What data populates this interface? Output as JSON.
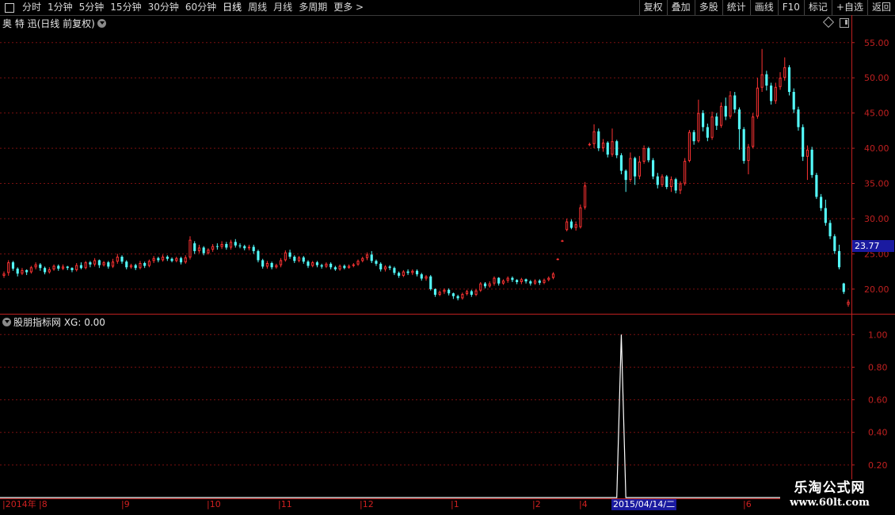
{
  "toolbar": {
    "periods": [
      "分时",
      "1分钟",
      "5分钟",
      "15分钟",
      "30分钟",
      "60分钟",
      "日线",
      "周线",
      "月线",
      "多周期",
      "更多 >"
    ],
    "active_period": "日线",
    "right_buttons": [
      "复权",
      "叠加",
      "多股",
      "统计",
      "画线",
      "F10",
      "标记",
      "+自选",
      "返回"
    ]
  },
  "stock": {
    "title": "奥 特 迅(日线 前复权)",
    "last_price_tag": "23.77"
  },
  "indicator": {
    "title": "股朋指标网  XG: 0.00"
  },
  "price_axis": {
    "labels": [
      "55.00",
      "50.00",
      "45.00",
      "40.00",
      "35.00",
      "30.00",
      "25.00",
      "20.00"
    ],
    "colors": {
      "up": "#ff3333",
      "down": "#54fcfc",
      "grid": "#7a1010",
      "axis": "#c02020"
    }
  },
  "indicator_axis": {
    "labels": [
      "1.00",
      "0.80",
      "0.60",
      "0.40",
      "0.20"
    ]
  },
  "time_axis": {
    "labels": [
      "2014年",
      "8",
      "9",
      "10",
      "11",
      "12",
      "1",
      "2",
      "4",
      "6"
    ],
    "cursor_date": "2015/04/14/二"
  },
  "watermark": {
    "name": "乐淘公式网",
    "url": "www.60lt.com"
  },
  "chart_data": [
    {
      "type": "candlestick",
      "title": "奥 特 迅(日线 前复权)",
      "ylim": [
        16.5,
        57
      ],
      "candles": [
        [
          21.9,
          22.2,
          21.6,
          22.5
        ],
        [
          22.3,
          23.8,
          21.9,
          24.1
        ],
        [
          23.8,
          22.9,
          22.6,
          24.0
        ],
        [
          22.9,
          22.2,
          21.8,
          23.1
        ],
        [
          22.2,
          22.7,
          22.0,
          23.0
        ],
        [
          22.7,
          22.4,
          22.0,
          22.8
        ],
        [
          22.4,
          23.1,
          22.2,
          23.3
        ],
        [
          23.1,
          23.5,
          22.8,
          23.8
        ],
        [
          23.5,
          23.0,
          22.6,
          23.7
        ],
        [
          23.0,
          22.4,
          22.1,
          23.2
        ],
        [
          22.4,
          22.8,
          22.2,
          23.1
        ],
        [
          22.8,
          23.3,
          22.6,
          23.5
        ],
        [
          23.3,
          22.9,
          22.6,
          23.5
        ],
        [
          22.9,
          23.2,
          22.7,
          23.5
        ],
        [
          23.2,
          23.0,
          22.7,
          23.3
        ],
        [
          23.0,
          22.7,
          22.4,
          23.1
        ],
        [
          22.7,
          23.4,
          22.5,
          23.7
        ],
        [
          23.4,
          23.0,
          22.8,
          23.8
        ],
        [
          23.0,
          23.8,
          22.8,
          24.0
        ],
        [
          23.8,
          23.5,
          23.1,
          24.0
        ],
        [
          23.5,
          24.1,
          23.2,
          24.4
        ],
        [
          24.1,
          23.4,
          23.0,
          24.2
        ],
        [
          23.4,
          23.8,
          23.2,
          24.0
        ],
        [
          23.8,
          23.2,
          22.9,
          24.0
        ],
        [
          23.2,
          23.9,
          23.0,
          24.3
        ],
        [
          23.9,
          24.6,
          23.6,
          25.0
        ],
        [
          24.6,
          23.9,
          23.6,
          24.8
        ],
        [
          23.9,
          23.1,
          22.8,
          24.1
        ],
        [
          23.1,
          23.4,
          22.9,
          23.6
        ],
        [
          23.4,
          23.0,
          22.7,
          23.6
        ],
        [
          23.0,
          23.7,
          22.8,
          24.0
        ],
        [
          23.7,
          23.3,
          23.0,
          23.9
        ],
        [
          23.3,
          24.0,
          23.1,
          24.2
        ],
        [
          24.0,
          24.4,
          23.7,
          24.7
        ],
        [
          24.4,
          24.1,
          23.8,
          24.6
        ],
        [
          24.1,
          24.6,
          23.9,
          24.9
        ],
        [
          24.6,
          24.3,
          24.0,
          24.8
        ],
        [
          24.3,
          24.0,
          23.8,
          24.5
        ],
        [
          24.0,
          24.4,
          23.8,
          24.6
        ],
        [
          24.4,
          23.8,
          23.5,
          24.6
        ],
        [
          23.8,
          24.5,
          23.6,
          24.8
        ],
        [
          24.5,
          27.0,
          24.2,
          27.5
        ],
        [
          26.5,
          25.4,
          25.0,
          26.8
        ],
        [
          25.4,
          25.9,
          25.1,
          26.3
        ],
        [
          25.9,
          25.1,
          24.8,
          26.1
        ],
        [
          25.1,
          25.6,
          24.9,
          25.8
        ],
        [
          25.6,
          26.1,
          25.3,
          26.4
        ],
        [
          26.1,
          26.0,
          25.6,
          26.5
        ],
        [
          26.0,
          26.4,
          25.7,
          26.8
        ],
        [
          26.4,
          25.9,
          25.6,
          26.7
        ],
        [
          25.9,
          26.7,
          25.6,
          27.0
        ],
        [
          26.7,
          26.2,
          25.9,
          27.1
        ],
        [
          26.2,
          26.1,
          25.8,
          26.5
        ],
        [
          26.1,
          25.8,
          25.5,
          26.3
        ],
        [
          25.8,
          26.0,
          25.5,
          26.3
        ],
        [
          26.0,
          25.4,
          25.0,
          26.3
        ],
        [
          25.4,
          24.1,
          23.8,
          25.6
        ],
        [
          24.1,
          23.2,
          22.9,
          24.3
        ],
        [
          23.2,
          23.7,
          22.9,
          24.0
        ],
        [
          23.7,
          23.1,
          22.8,
          23.9
        ],
        [
          23.1,
          23.4,
          22.9,
          23.6
        ],
        [
          23.4,
          24.1,
          23.1,
          24.4
        ],
        [
          24.1,
          25.2,
          23.9,
          25.5
        ],
        [
          25.2,
          24.6,
          24.3,
          25.6
        ],
        [
          24.6,
          24.0,
          23.7,
          24.8
        ],
        [
          24.0,
          24.5,
          23.8,
          24.7
        ],
        [
          24.5,
          23.9,
          23.6,
          24.7
        ],
        [
          23.9,
          23.3,
          23.0,
          24.1
        ],
        [
          23.3,
          23.8,
          23.1,
          24.0
        ],
        [
          23.8,
          23.4,
          23.1,
          24.0
        ],
        [
          23.4,
          23.2,
          22.9,
          23.6
        ],
        [
          23.2,
          23.6,
          23.0,
          23.8
        ],
        [
          23.6,
          23.1,
          22.8,
          23.8
        ],
        [
          23.1,
          22.8,
          22.6,
          23.3
        ],
        [
          22.8,
          23.3,
          22.6,
          23.5
        ],
        [
          23.3,
          23.0,
          22.8,
          23.5
        ],
        [
          23.0,
          23.3,
          22.9,
          23.5
        ],
        [
          23.3,
          23.5,
          23.1,
          23.7
        ],
        [
          23.5,
          24.0,
          23.3,
          24.2
        ],
        [
          24.0,
          24.4,
          23.8,
          24.6
        ],
        [
          24.4,
          24.9,
          24.1,
          25.2
        ],
        [
          24.9,
          24.0,
          23.7,
          25.4
        ],
        [
          24.0,
          23.6,
          23.3,
          24.2
        ],
        [
          23.6,
          22.8,
          22.5,
          23.8
        ],
        [
          22.8,
          23.2,
          22.5,
          23.4
        ],
        [
          23.2,
          23.0,
          22.7,
          23.4
        ],
        [
          23.0,
          22.3,
          22.0,
          23.2
        ],
        [
          22.3,
          21.9,
          21.6,
          22.5
        ],
        [
          21.9,
          22.5,
          21.7,
          22.7
        ],
        [
          22.5,
          22.3,
          22.0,
          22.8
        ],
        [
          22.3,
          22.6,
          22.0,
          22.8
        ],
        [
          22.6,
          22.1,
          21.8,
          22.8
        ],
        [
          22.1,
          21.5,
          21.2,
          22.3
        ],
        [
          21.5,
          21.8,
          21.2,
          22.0
        ],
        [
          21.8,
          20.0,
          19.8,
          22.0
        ],
        [
          20.0,
          19.2,
          18.9,
          20.1
        ],
        [
          19.2,
          19.6,
          19.0,
          19.8
        ],
        [
          19.6,
          19.9,
          19.3,
          20.1
        ],
        [
          19.9,
          19.4,
          19.1,
          20.1
        ],
        [
          19.4,
          19.0,
          18.6,
          19.5
        ],
        [
          19.0,
          18.7,
          18.4,
          19.2
        ],
        [
          18.7,
          19.3,
          18.5,
          19.5
        ],
        [
          19.3,
          19.7,
          19.1,
          19.9
        ],
        [
          19.7,
          19.2,
          18.9,
          19.9
        ],
        [
          19.2,
          19.8,
          19.0,
          20.0
        ],
        [
          19.8,
          20.8,
          19.6,
          21.0
        ],
        [
          20.8,
          20.4,
          20.1,
          21.0
        ],
        [
          20.4,
          20.8,
          20.2,
          21.1
        ],
        [
          20.8,
          21.6,
          20.5,
          21.8
        ],
        [
          21.6,
          20.8,
          20.5,
          21.7
        ],
        [
          20.8,
          21.2,
          20.6,
          21.4
        ],
        [
          21.2,
          21.6,
          20.9,
          21.8
        ],
        [
          21.6,
          21.3,
          21.0,
          21.8
        ],
        [
          21.3,
          21.0,
          20.7,
          21.4
        ],
        [
          21.0,
          21.4,
          20.7,
          21.6
        ],
        [
          21.4,
          21.1,
          20.8,
          21.5
        ],
        [
          21.1,
          20.8,
          20.5,
          21.3
        ],
        [
          20.8,
          21.2,
          20.6,
          21.4
        ],
        [
          21.2,
          20.9,
          20.6,
          21.4
        ],
        [
          20.9,
          21.3,
          20.7,
          21.5
        ],
        [
          21.3,
          21.6,
          21.1,
          21.8
        ],
        [
          21.6,
          22.2,
          21.4,
          22.4
        ],
        [
          24.2,
          24.3,
          24.1,
          24.4
        ],
        [
          26.8,
          26.9,
          26.7,
          27.0
        ],
        [
          28.4,
          29.6,
          28.2,
          30.0
        ],
        [
          29.6,
          28.7,
          28.5,
          29.9
        ],
        [
          28.7,
          29.2,
          28.3,
          29.6
        ],
        [
          28.8,
          31.6,
          28.6,
          32.0
        ],
        [
          31.6,
          34.7,
          31.3,
          35.2
        ],
        [
          40.5,
          40.6,
          40.3,
          40.8
        ],
        [
          40.6,
          42.4,
          40.0,
          43.4
        ],
        [
          42.4,
          40.0,
          39.6,
          42.8
        ],
        [
          40.0,
          40.8,
          39.5,
          41.3
        ],
        [
          40.8,
          39.1,
          38.7,
          41.0
        ],
        [
          39.1,
          41.0,
          38.8,
          42.8
        ],
        [
          41.0,
          39.0,
          38.6,
          41.2
        ],
        [
          39.0,
          36.8,
          36.3,
          39.3
        ],
        [
          36.8,
          35.5,
          33.8,
          37.0
        ],
        [
          35.5,
          38.6,
          35.2,
          39.4
        ],
        [
          38.6,
          36.0,
          34.8,
          38.8
        ],
        [
          36.0,
          38.1,
          35.6,
          38.9
        ],
        [
          38.1,
          40.0,
          37.8,
          40.4
        ],
        [
          40.0,
          38.3,
          38.0,
          40.2
        ],
        [
          38.3,
          36.0,
          35.6,
          38.6
        ],
        [
          36.0,
          34.8,
          34.3,
          36.5
        ],
        [
          34.8,
          36.0,
          34.5,
          36.3
        ],
        [
          36.0,
          34.5,
          34.2,
          36.2
        ],
        [
          34.5,
          35.6,
          33.8,
          36.0
        ],
        [
          35.6,
          34.0,
          33.6,
          35.8
        ],
        [
          34.0,
          35.0,
          33.5,
          35.3
        ],
        [
          35.0,
          38.2,
          34.7,
          38.6
        ],
        [
          38.2,
          42.3,
          38.0,
          42.6
        ],
        [
          42.3,
          41.0,
          40.5,
          42.6
        ],
        [
          41.0,
          45.0,
          40.8,
          46.9
        ],
        [
          45.0,
          43.0,
          42.4,
          45.4
        ],
        [
          43.0,
          41.5,
          41.0,
          43.5
        ],
        [
          41.5,
          44.5,
          41.2,
          45.2
        ],
        [
          44.5,
          43.2,
          42.6,
          45.0
        ],
        [
          43.2,
          46.0,
          42.9,
          46.5
        ],
        [
          46.0,
          44.5,
          44.0,
          47.2
        ],
        [
          44.5,
          47.5,
          44.2,
          48.1
        ],
        [
          47.5,
          45.5,
          45.0,
          48.0
        ],
        [
          45.5,
          42.7,
          39.8,
          45.8
        ],
        [
          42.7,
          38.2,
          37.8,
          43.0
        ],
        [
          38.2,
          40.2,
          36.3,
          40.6
        ],
        [
          40.2,
          44.5,
          40.0,
          45.0
        ],
        [
          44.5,
          48.6,
          44.2,
          50.0
        ],
        [
          48.6,
          50.5,
          48.0,
          54.1
        ],
        [
          50.5,
          48.9,
          48.2,
          51.0
        ],
        [
          48.9,
          46.7,
          46.2,
          49.3
        ],
        [
          46.7,
          48.7,
          46.3,
          49.3
        ],
        [
          48.7,
          50.0,
          48.3,
          50.8
        ],
        [
          50.0,
          51.5,
          49.6,
          52.9
        ],
        [
          51.5,
          48.0,
          47.5,
          51.8
        ],
        [
          48.0,
          45.5,
          45.0,
          48.5
        ],
        [
          45.5,
          43.0,
          42.5,
          45.9
        ],
        [
          43.0,
          38.8,
          38.2,
          43.4
        ],
        [
          38.8,
          39.8,
          35.5,
          40.4
        ],
        [
          39.8,
          36.2,
          35.8,
          40.2
        ],
        [
          36.2,
          33.1,
          32.8,
          36.5
        ],
        [
          33.1,
          31.5,
          31.1,
          33.5
        ],
        [
          31.5,
          29.4,
          29.0,
          32.7
        ],
        [
          29.4,
          27.5,
          27.1,
          29.8
        ],
        [
          27.5,
          25.4,
          25.0,
          27.8
        ],
        [
          25.4,
          23.1,
          22.8,
          26.3
        ],
        [
          20.8,
          19.6,
          19.3,
          20.9
        ],
        [
          17.8,
          18.2,
          17.5,
          18.5
        ]
      ]
    },
    {
      "type": "line",
      "title": "股朋指标网  XG: 0.00",
      "ylim": [
        0,
        1.05
      ],
      "signal_bar_index": 136,
      "signal_value": 1.0,
      "other_values": 0.0
    }
  ]
}
